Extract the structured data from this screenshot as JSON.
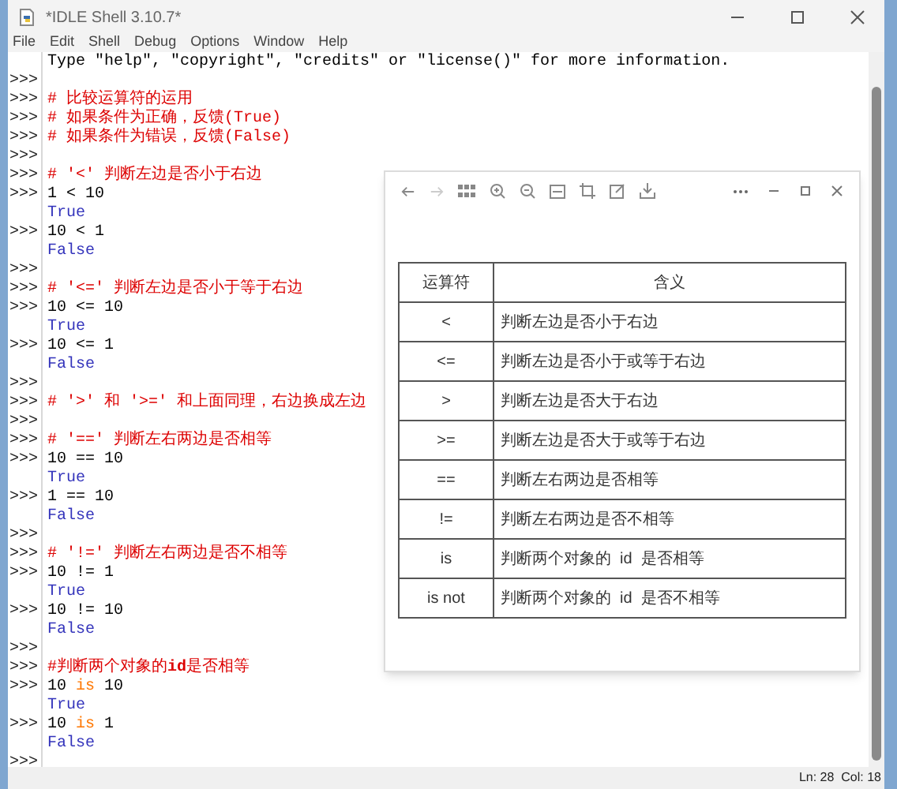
{
  "window": {
    "title": "*IDLE Shell 3.10.7*"
  },
  "menu": [
    "File",
    "Edit",
    "Shell",
    "Debug",
    "Options",
    "Window",
    "Help"
  ],
  "shell": {
    "lines": [
      {
        "segments": [
          {
            "kind": "plain",
            "text": "Type \"help\", \"copyright\", \"credits\" or \"license()\" for more information."
          }
        ]
      },
      {
        "prompt": ">>>"
      },
      {
        "prompt": ">>>",
        "segments": [
          {
            "kind": "comment",
            "text": "# 比较运算符的运用"
          }
        ]
      },
      {
        "prompt": ">>>",
        "segments": [
          {
            "kind": "comment",
            "text": "# 如果条件为正确，反馈(True)"
          }
        ]
      },
      {
        "prompt": ">>>",
        "segments": [
          {
            "kind": "comment",
            "text": "# 如果条件为错误，反馈(False)"
          }
        ]
      },
      {
        "prompt": ">>>"
      },
      {
        "prompt": ">>>",
        "segments": [
          {
            "kind": "comment",
            "text": "# '<' 判断左边是否小于右边"
          }
        ]
      },
      {
        "prompt": ">>>",
        "segments": [
          {
            "kind": "plain",
            "text": "1 < 10"
          }
        ]
      },
      {
        "segments": [
          {
            "kind": "output",
            "text": "True"
          }
        ]
      },
      {
        "prompt": ">>>",
        "segments": [
          {
            "kind": "plain",
            "text": "10 < 1"
          }
        ]
      },
      {
        "segments": [
          {
            "kind": "output",
            "text": "False"
          }
        ]
      },
      {
        "prompt": ">>>"
      },
      {
        "prompt": ">>>",
        "segments": [
          {
            "kind": "comment",
            "text": "# '<=' 判断左边是否小于等于右边"
          }
        ]
      },
      {
        "prompt": ">>>",
        "segments": [
          {
            "kind": "plain",
            "text": "10 <= 10"
          }
        ]
      },
      {
        "segments": [
          {
            "kind": "output",
            "text": "True"
          }
        ]
      },
      {
        "prompt": ">>>",
        "segments": [
          {
            "kind": "plain",
            "text": "10 <= 1"
          }
        ]
      },
      {
        "segments": [
          {
            "kind": "output",
            "text": "False"
          }
        ]
      },
      {
        "prompt": ">>>"
      },
      {
        "prompt": ">>>",
        "segments": [
          {
            "kind": "comment",
            "text": "# '>' 和 '>=' 和上面同理，右边换成左边"
          }
        ]
      },
      {
        "prompt": ">>>"
      },
      {
        "prompt": ">>>",
        "segments": [
          {
            "kind": "comment",
            "text": "# '==' 判断左右两边是否相等"
          }
        ]
      },
      {
        "prompt": ">>>",
        "segments": [
          {
            "kind": "plain",
            "text": "10 == 10"
          }
        ]
      },
      {
        "segments": [
          {
            "kind": "output",
            "text": "True"
          }
        ]
      },
      {
        "prompt": ">>>",
        "segments": [
          {
            "kind": "plain",
            "text": "1 == 10"
          }
        ]
      },
      {
        "segments": [
          {
            "kind": "output",
            "text": "False"
          }
        ]
      },
      {
        "prompt": ">>>"
      },
      {
        "prompt": ">>>",
        "segments": [
          {
            "kind": "comment",
            "text": "# '!=' 判断左右两边是否不相等"
          }
        ]
      },
      {
        "prompt": ">>>",
        "segments": [
          {
            "kind": "plain",
            "text": "10 != 1"
          }
        ]
      },
      {
        "segments": [
          {
            "kind": "output",
            "text": "True"
          }
        ]
      },
      {
        "prompt": ">>>",
        "segments": [
          {
            "kind": "plain",
            "text": "10 != 10"
          }
        ]
      },
      {
        "segments": [
          {
            "kind": "output",
            "text": "False"
          }
        ]
      },
      {
        "prompt": ">>>"
      },
      {
        "prompt": ">>>",
        "segments": [
          {
            "kind": "comment",
            "text": "#判断两个对象的**id**是否相等"
          }
        ]
      },
      {
        "prompt": ">>>",
        "segments": [
          {
            "kind": "plain",
            "text": "10 "
          },
          {
            "kind": "keyword",
            "text": "is"
          },
          {
            "kind": "plain",
            "text": " 10"
          }
        ]
      },
      {
        "segments": [
          {
            "kind": "output",
            "text": "True"
          }
        ]
      },
      {
        "prompt": ">>>",
        "segments": [
          {
            "kind": "plain",
            "text": "10 "
          },
          {
            "kind": "keyword",
            "text": "is"
          },
          {
            "kind": "plain",
            "text": " 1"
          }
        ]
      },
      {
        "segments": [
          {
            "kind": "output",
            "text": "False"
          }
        ]
      },
      {
        "prompt": ">>>"
      }
    ]
  },
  "viewer": {
    "table": {
      "columns": [
        "运算符",
        "含义"
      ],
      "rows": [
        [
          "<",
          "判断左边是否小于右边"
        ],
        [
          "<=",
          "判断左边是否小于或等于右边"
        ],
        [
          ">",
          "判断左边是否大于右边"
        ],
        [
          ">=",
          "判断左边是否大于或等于右边"
        ],
        [
          "==",
          "判断左右两边是否相等"
        ],
        [
          "!=",
          "判断左右两边是否不相等"
        ],
        [
          "is",
          "判断两个对象的  id  是否相等"
        ],
        [
          "is not",
          "判断两个对象的  id  是否不相等"
        ]
      ]
    }
  },
  "status_bar": {
    "position": "Ln: 28  Col: 18"
  }
}
